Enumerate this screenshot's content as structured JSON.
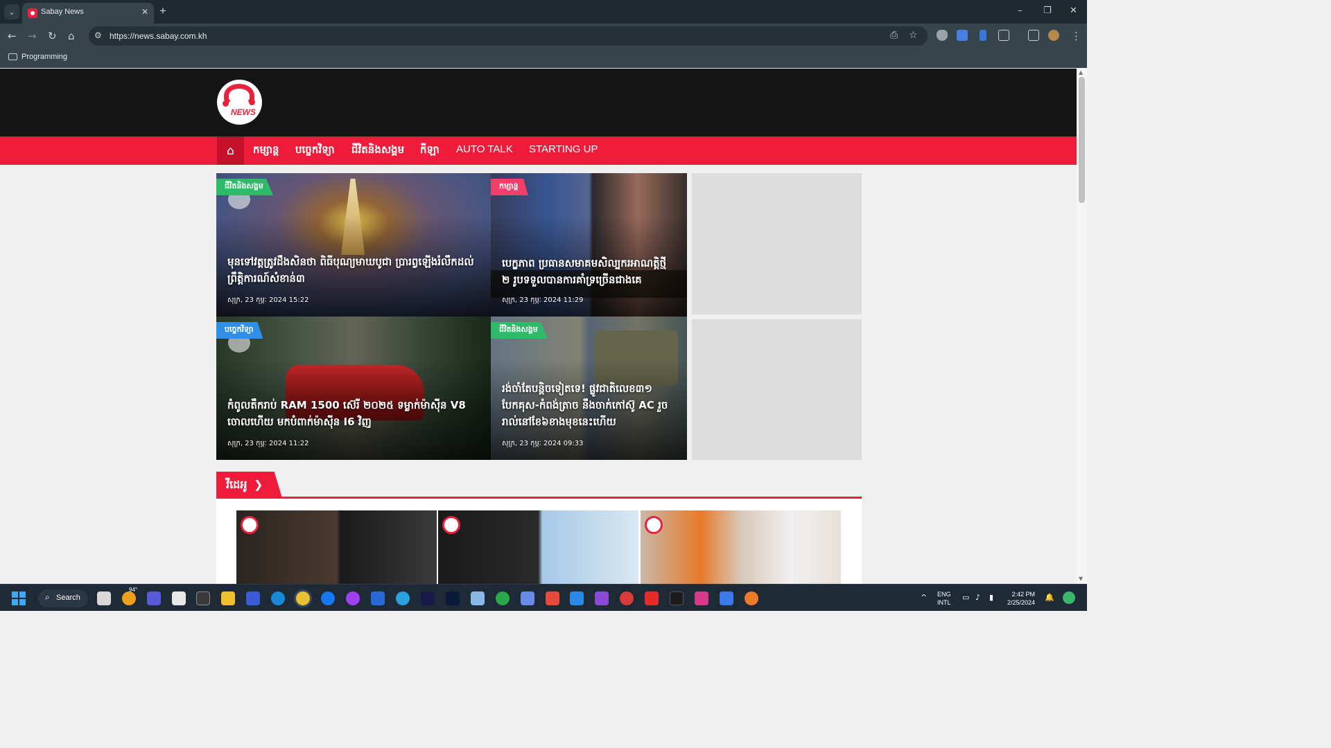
{
  "browser": {
    "tab_title": "Sabay News",
    "tab_close": "✕",
    "new_tab": "+",
    "url": "https://news.sabay.com.kh",
    "bookmark_folder": "Programming",
    "window_controls": [
      "–",
      "❐",
      "✕"
    ]
  },
  "site": {
    "logo_text": "NEWS",
    "nav": {
      "home_icon": "home-icon",
      "items": [
        "កម្សាន្ត",
        "បច្ចេកវិទ្យា",
        "ជីវិតនិងសង្គម",
        "កីឡា",
        "AUTO TALK",
        "STARTING UP"
      ]
    },
    "featured": [
      {
        "category": "ជីវិតនិងសង្គម",
        "category_color": "#2dbb6a",
        "title": "មុនទៅវត្តត្រូវដឹងសិនថា ពិធីបុណ្យមាឃបូជា ប្រារព្វឡើងរំលឹកដល់ព្រឹត្តិការណ៍សំខាន់៣",
        "date": "សុក្រ, 23 កុម្ភៈ 2024 15:22"
      },
      {
        "category": "កម្សាន្ត",
        "category_color": "#f0406a",
        "title": "បេក្ខភាព ប្រធានសមាគមសិល្បករអាណត្តិថ្មី ២ រូបទទួលបានការគាំទ្រច្រើនជាងគេ",
        "date": "សុក្រ, 23 កុម្ភៈ 2024 11:29"
      },
      {
        "category": "បច្ចេកវិទ្យា",
        "category_color": "#2f8fe8",
        "title": "កំពូលតឹករាប់ RAM 1500 ស៊េរី ២០២៥ ទម្លាក់ម៉ាស៊ីន V8 ចោលហើយ មកបំពាក់ម៉ាស៊ីន I6 វិញ",
        "date": "សុក្រ, 23 កុម្ភៈ 2024 11:22"
      },
      {
        "category": "ជីវិតនិងសង្គម",
        "category_color": "#2dbb6a",
        "title": "រង់ចាំតែបន្តិចទៀតទេ! ផ្លូវជាតិលេខ៣១ បែកគុស-កំពង់ត្រាច នឹងចាក់កៅស៊ូ AC រួចរាល់នៅខែ៦ខាងមុខនេះហើយ",
        "date": "សុក្រ, 23 កុម្ភៈ 2024 09:33"
      }
    ],
    "section": {
      "title": "វីដេអូ",
      "arrow": "❯"
    }
  },
  "taskbar": {
    "search_label": "Search",
    "weather_temp": "94°",
    "lang_line1": "ENG",
    "lang_line2": "INTL",
    "time": "2:42 PM",
    "date": "2/25/2024",
    "tray_chevron": "^"
  }
}
